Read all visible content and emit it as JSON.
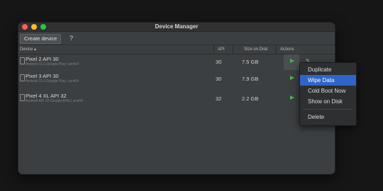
{
  "window": {
    "title": "Device Manager"
  },
  "toolbar": {
    "create_label": "Create device",
    "help_label": "?"
  },
  "table": {
    "headers": {
      "device": "Device ▴",
      "api": "API",
      "size": "Size on Disk",
      "actions": "Actions"
    },
    "rows": [
      {
        "name": "Pixel 2 API 30",
        "sub": "Android 11.0 Google Play | arm64",
        "api": "30",
        "size": "7.5 GB"
      },
      {
        "name": "Pixel 3 API 30",
        "sub": "Android 11.0 Google Play | arm64",
        "api": "30",
        "size": "7.9 GB"
      },
      {
        "name": "Pixel 4 XL API 32",
        "sub": "Android API 32 Google APIs | arm64",
        "api": "32",
        "size": "2.2 GB"
      }
    ]
  },
  "context_menu": {
    "items": [
      "Duplicate",
      "Wipe Data",
      "Cold Boot Now",
      "Show on Disk",
      "Delete"
    ],
    "selected": "Wipe Data"
  },
  "colors": {
    "accent": "#2f65ca",
    "play": "#4caf50"
  }
}
